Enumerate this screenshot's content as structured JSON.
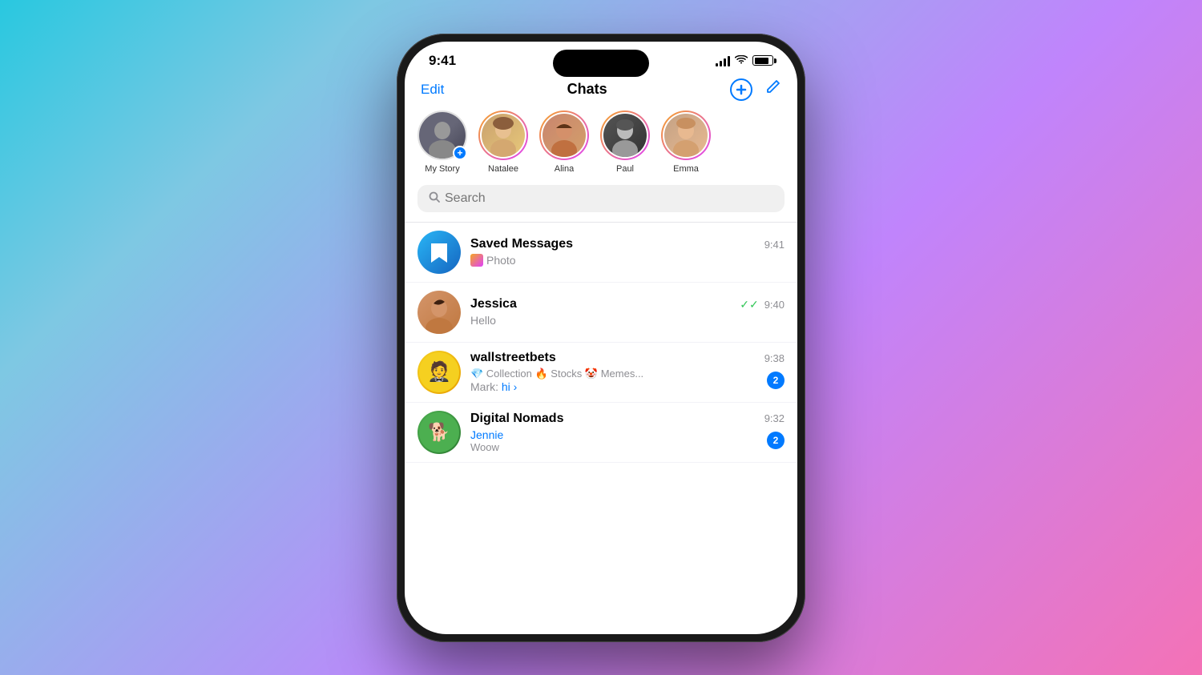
{
  "phone": {
    "status_bar": {
      "time": "9:41",
      "signal_bars": [
        4,
        7,
        10,
        13
      ],
      "wifi": "wifi",
      "battery_level": 85
    },
    "header": {
      "edit_label": "Edit",
      "title": "Chats",
      "add_label": "+",
      "compose_label": "✏"
    },
    "stories": [
      {
        "id": "my-story",
        "label": "My Story",
        "has_ring": false,
        "has_add": true,
        "color": "av-my"
      },
      {
        "id": "natalee",
        "label": "Natalee",
        "has_ring": true,
        "has_add": false,
        "color": "av-natalee"
      },
      {
        "id": "alina",
        "label": "Alina",
        "has_ring": true,
        "has_add": false,
        "color": "av-alina"
      },
      {
        "id": "paul",
        "label": "Paul",
        "has_ring": true,
        "has_add": false,
        "color": "av-paul"
      },
      {
        "id": "emma",
        "label": "Emma",
        "has_ring": true,
        "has_add": false,
        "color": "av-emma"
      }
    ],
    "search": {
      "placeholder": "Search"
    },
    "chats": [
      {
        "id": "saved-messages",
        "name": "Saved Messages",
        "time": "9:41",
        "preview": "Photo",
        "type": "saved",
        "unread": 0,
        "read": false
      },
      {
        "id": "jessica",
        "name": "Jessica",
        "time": "9:40",
        "preview": "Hello",
        "type": "person",
        "color": "jessica-avatar",
        "unread": 0,
        "read": true
      },
      {
        "id": "wallstreetbets",
        "name": "wallstreetbets",
        "time": "9:38",
        "preview_line1": "💎 Collection 🔥 Stocks 🤡 Memes...",
        "preview_line2": "Mark: hi",
        "type": "group",
        "color": "wsb-avatar",
        "unread": 2,
        "read": false
      },
      {
        "id": "digital-nomads",
        "name": "Digital Nomads",
        "time": "9:32",
        "preview_name": "Jennie",
        "preview": "Woow",
        "type": "group",
        "color": "nomads-avatar",
        "unread": 2,
        "read": false
      }
    ]
  }
}
